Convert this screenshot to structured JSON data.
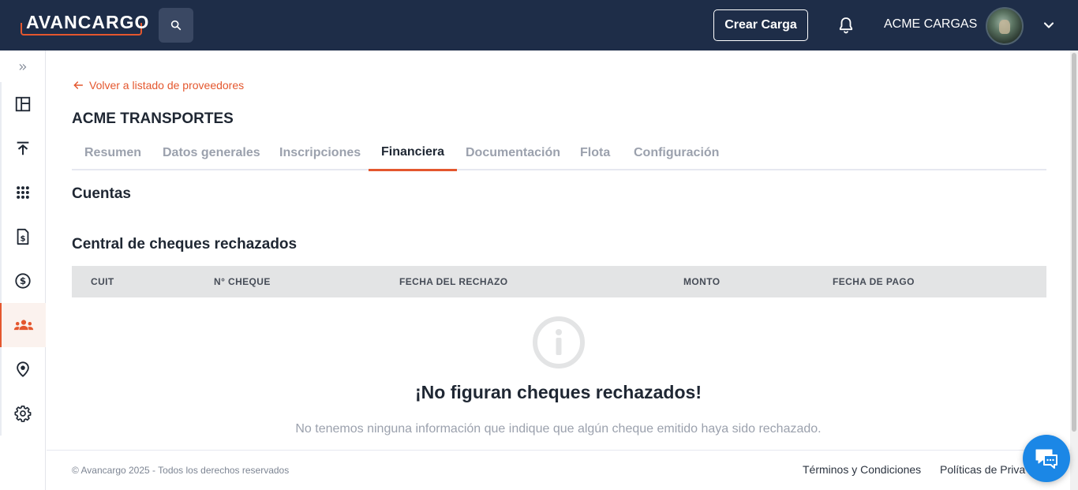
{
  "app": {
    "logo_text": "AVANCARGO",
    "accent_color": "#e4572e",
    "nav_color": "#1e2d48"
  },
  "header": {
    "search_icon": "search-icon",
    "create_button_label": "Crear Carga",
    "notifications_icon": "bell-icon",
    "company_name": "ACME CARGAS",
    "user_menu_icon": "chevron-down-icon"
  },
  "sidebar": {
    "expand_icon": "double-chevron-right-icon",
    "items": [
      {
        "icon": "dashboard-icon",
        "active": false
      },
      {
        "icon": "upload-icon",
        "active": false
      },
      {
        "icon": "grid-icon",
        "active": false
      },
      {
        "icon": "invoice-icon",
        "active": false
      },
      {
        "icon": "dollar-icon",
        "active": false
      },
      {
        "icon": "people-icon",
        "active": true
      },
      {
        "icon": "location-icon",
        "active": false
      },
      {
        "icon": "settings-icon",
        "active": false
      }
    ]
  },
  "main": {
    "back_link": "Volver a listado de proveedores",
    "title": "ACME TRANSPORTES",
    "tabs": [
      {
        "label": "Resumen",
        "active": false
      },
      {
        "label": "Datos generales",
        "active": false
      },
      {
        "label": "Inscripciones",
        "active": false
      },
      {
        "label": "Financiera",
        "active": true
      },
      {
        "label": "Documentación",
        "active": false
      },
      {
        "label": "Flota",
        "active": false
      },
      {
        "label": "Configuración",
        "active": false
      }
    ],
    "accounts_title": "Cuentas",
    "cheques_title": "Central de cheques rechazados",
    "table_headers": [
      "CUIT",
      "N° CHEQUE",
      "FECHA DEL RECHAZO",
      "MONTO",
      "FECHA DE PAGO"
    ],
    "empty_icon": "info-icon",
    "empty_title": "¡No figuran cheques rechazados!",
    "empty_text": "No tenemos ninguna información que indique que algún cheque emitido haya sido rechazado."
  },
  "footer": {
    "copyright": "© Avancargo 2025 - Todos los derechos reservados",
    "terms": "Términos y Condiciones",
    "privacy": "Políticas de Priva"
  },
  "chat": {
    "icon": "chat-icon"
  }
}
